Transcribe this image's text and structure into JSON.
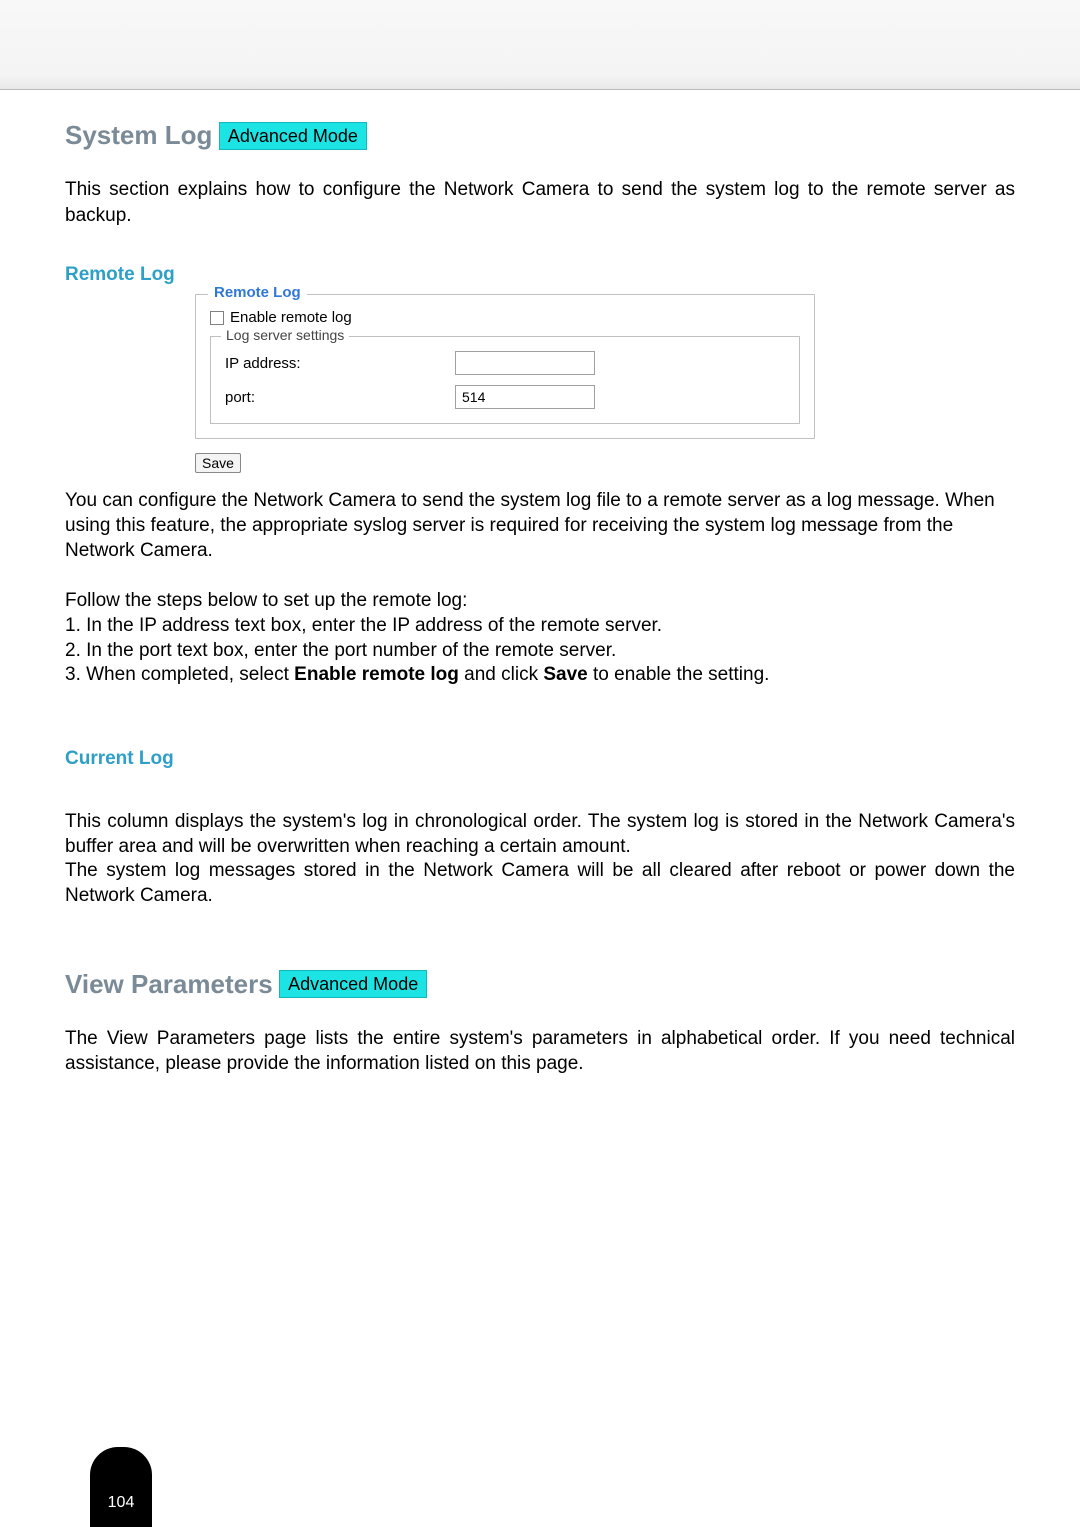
{
  "section1": {
    "title": "System Log",
    "badge": "Advanced Mode",
    "intro": "This section explains how to configure the Network Camera to send the system log to the remote server as backup."
  },
  "remote_log": {
    "heading": "Remote Log",
    "fieldset_title": "Remote Log",
    "enable_label": "Enable remote log",
    "inner_title": "Log server settings",
    "ip_label": "IP address:",
    "ip_value": "",
    "port_label": "port:",
    "port_value": "514",
    "save_label": "Save"
  },
  "remote_log_text": {
    "p1": "You can configure the Network Camera to send the system log file to a remote server as a log message. When using this feature, the appropriate syslog server is required for receiving the system log message from the Network Camera.",
    "steps_intro": "Follow the steps below to set up the remote log:",
    "s1": "1. In the IP address text box, enter the IP address of the remote server.",
    "s2": "2. In the port text box, enter the port number of the remote server.",
    "s3_prefix": "3. When completed, select ",
    "s3_strong1": "Enable remote log",
    "s3_mid": " and click ",
    "s3_strong2": "Save",
    "s3_suffix": " to enable the setting."
  },
  "current_log": {
    "heading": "Current Log",
    "p1": "This column displays the system's log in chronological order. The system log is stored in the Network Camera's buffer area and will be overwritten when reaching a certain amount.",
    "p2": "The system log messages stored in the Network Camera will be all cleared after reboot or power down the Network Camera."
  },
  "section2": {
    "title": "View Parameters",
    "badge": "Advanced Mode",
    "intro": "The View Parameters page lists the entire system's parameters in alphabetical order. If you need technical assistance, please provide the information listed on this page."
  },
  "page_number": "104"
}
